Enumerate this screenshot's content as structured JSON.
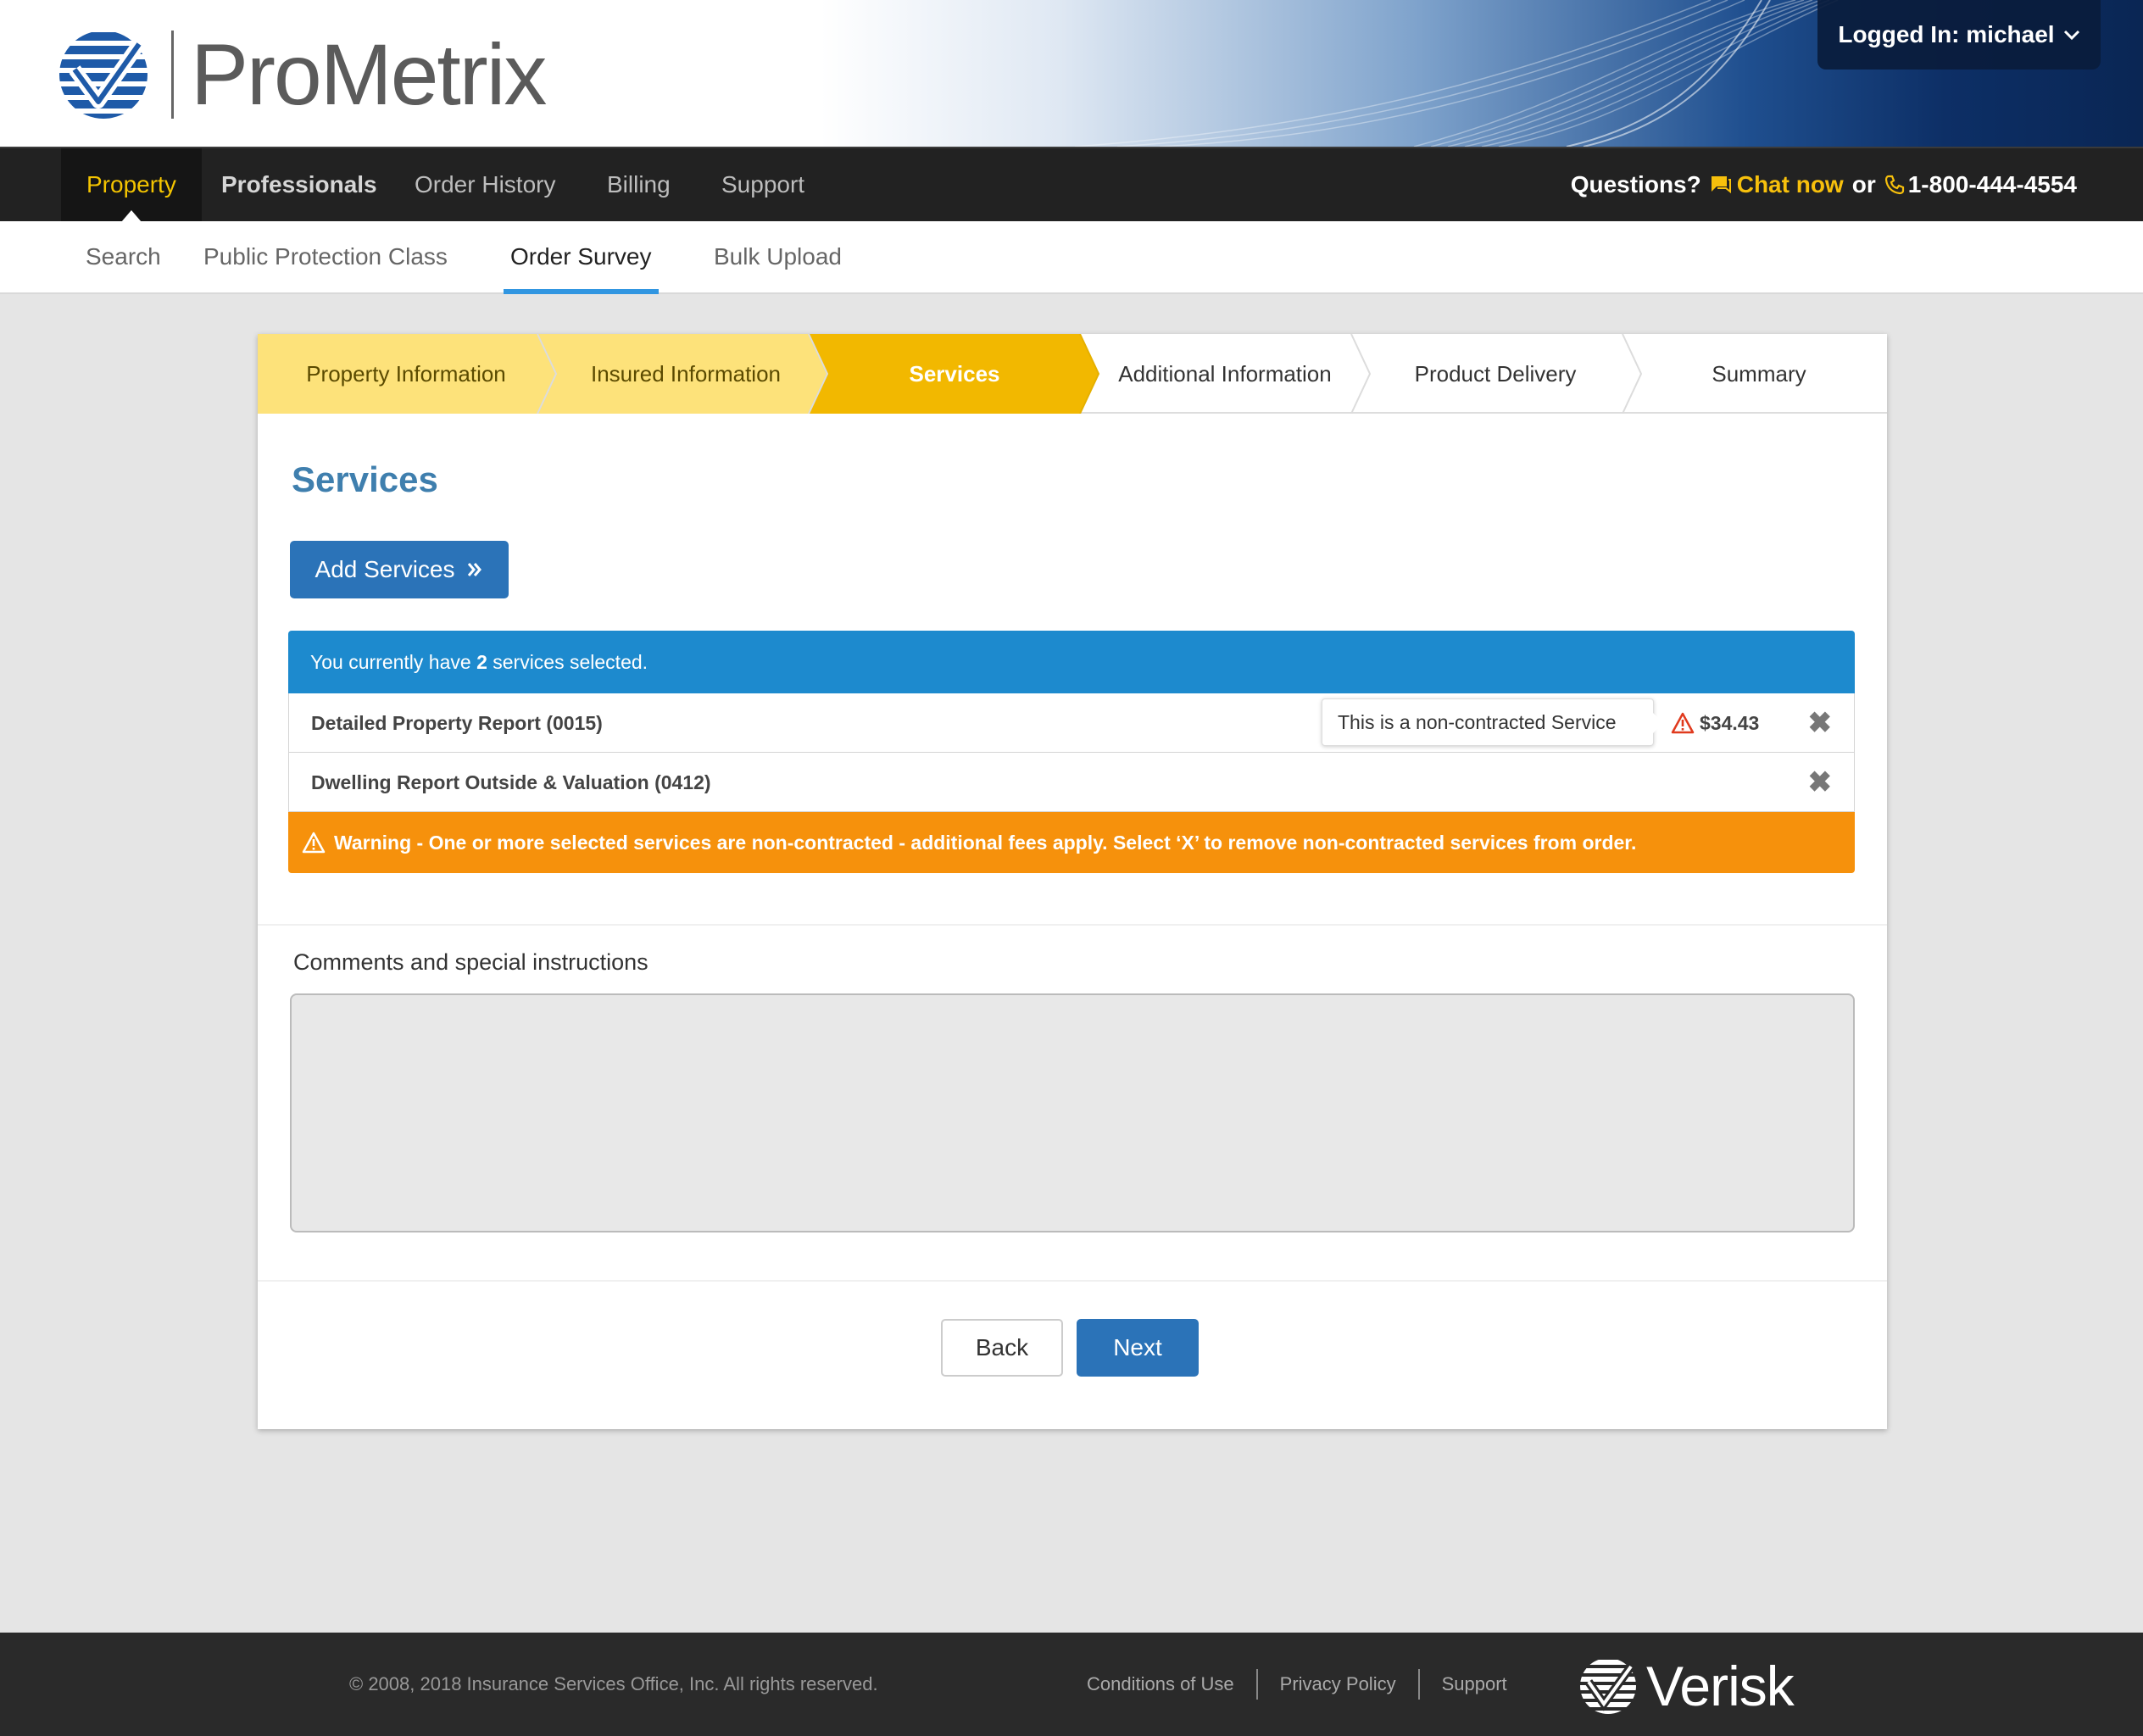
{
  "header": {
    "brand": "ProMetrix",
    "login_label": "Logged In: michael"
  },
  "nav": {
    "items": [
      {
        "label": "Property"
      },
      {
        "label": "Professionals"
      },
      {
        "label": "Order History"
      },
      {
        "label": "Billing"
      },
      {
        "label": "Support"
      }
    ],
    "questions": "Questions?",
    "chat": "Chat now",
    "or": "or",
    "phone": "1-800-444-4554"
  },
  "subnav": {
    "items": [
      {
        "label": "Search"
      },
      {
        "label": "Public Protection Class"
      },
      {
        "label": "Order Survey"
      },
      {
        "label": "Bulk Upload"
      }
    ]
  },
  "stepper": {
    "steps": [
      {
        "label": "Property Information",
        "state": "done"
      },
      {
        "label": "Insured Information",
        "state": "done"
      },
      {
        "label": "Services",
        "state": "current"
      },
      {
        "label": "Additional Information",
        "state": "pending"
      },
      {
        "label": "Product Delivery",
        "state": "pending"
      },
      {
        "label": "Summary",
        "state": "pending"
      }
    ]
  },
  "services": {
    "title": "Services",
    "add_button": "Add Services",
    "selected_prefix": "You currently have",
    "selected_count": "2",
    "selected_suffix": "services selected.",
    "rows": [
      {
        "name": "Detailed Property Report (0015)",
        "tooltip": "This is a non-contracted Service",
        "price": "$34.43"
      },
      {
        "name": "Dwelling Report Outside & Valuation (0412)"
      }
    ],
    "warning": "Warning - One or more selected services are non-contracted - additional fees apply. Select ‘X’ to remove non-contracted services from order."
  },
  "comments": {
    "label": "Comments and special instructions",
    "value": ""
  },
  "actions": {
    "back": "Back",
    "next": "Next"
  },
  "footer": {
    "copyright": "©  2008, 2018 Insurance Services Office, Inc. All rights reserved.",
    "links": [
      "Conditions of Use",
      "Privacy Policy",
      "Support"
    ],
    "brand": "Verisk"
  },
  "colors": {
    "accent_blue": "#2b73b8",
    "header_blue": "#1d8ace",
    "warning_orange": "#f6910c",
    "step_done": "#fde27a",
    "step_current": "#f2b800",
    "title_blue": "#3f7fae",
    "nav_active": "#f4c400"
  }
}
